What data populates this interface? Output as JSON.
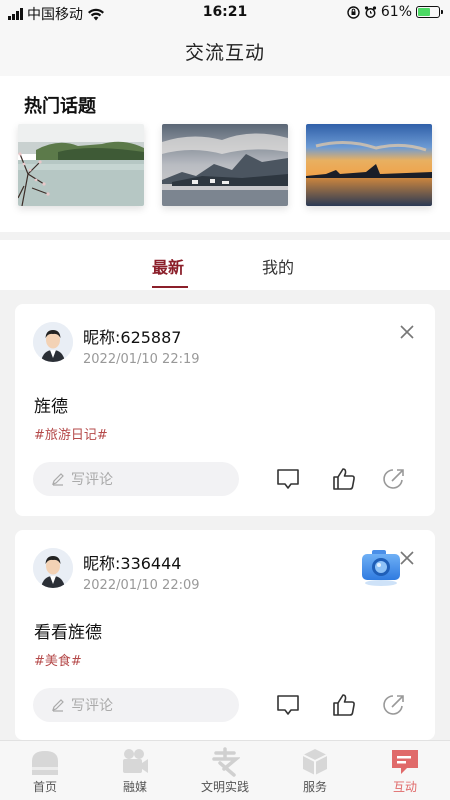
{
  "status_bar": {
    "carrier": "中国移动",
    "time": "16:21",
    "battery": "61%",
    "battery_level": 0.61
  },
  "header": {
    "title": "交流互动"
  },
  "hot_topics": {
    "title": "热门话题",
    "images": [
      "lake-blossom-image",
      "mountain-clouds-image",
      "sunset-lake-image"
    ]
  },
  "tabs": [
    {
      "label": "最新",
      "active": true
    },
    {
      "label": "我的",
      "active": false
    }
  ],
  "posts": [
    {
      "nickname": "昵称:625887",
      "time": "2022/01/10 22:19",
      "content": "旌德",
      "tag": "#旅游日记#",
      "comment_placeholder": "写评论"
    },
    {
      "nickname": "昵称:336444",
      "time": "2022/01/10 22:09",
      "content": "看看旌德",
      "tag": "#美食#",
      "comment_placeholder": "写评论"
    }
  ],
  "tabbar": [
    {
      "label": "首页",
      "icon": "home-icon",
      "active": false
    },
    {
      "label": "融媒",
      "icon": "video-camera-icon",
      "active": false
    },
    {
      "label": "文明实践",
      "icon": "civilization-icon",
      "active": false
    },
    {
      "label": "服务",
      "icon": "cube-icon",
      "active": false
    },
    {
      "label": "互动",
      "icon": "message-icon",
      "active": true
    }
  ],
  "colors": {
    "accent": "#8b1f2a",
    "tag": "#b54a4a",
    "tab_active": "#e06a6a"
  }
}
